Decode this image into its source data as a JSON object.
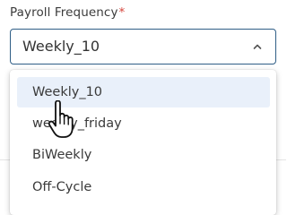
{
  "field": {
    "label": "Payroll Frequency",
    "required_marker": "*",
    "selected_value": "Weekly_10",
    "chevron_icon": "chevron-up-icon"
  },
  "dropdown": {
    "options": [
      {
        "label": "Weekly_10",
        "selected": true
      },
      {
        "label": "weekly_friday",
        "selected": false
      },
      {
        "label": "BiWeekly",
        "selected": false
      },
      {
        "label": "Off-Cycle",
        "selected": false
      }
    ]
  },
  "cursor": {
    "icon": "hand-pointer-icon"
  },
  "colors": {
    "border_focus": "#2f5e86",
    "required": "#d6453d",
    "selected_option_bg": "#e9f0fa",
    "text": "#333333"
  }
}
